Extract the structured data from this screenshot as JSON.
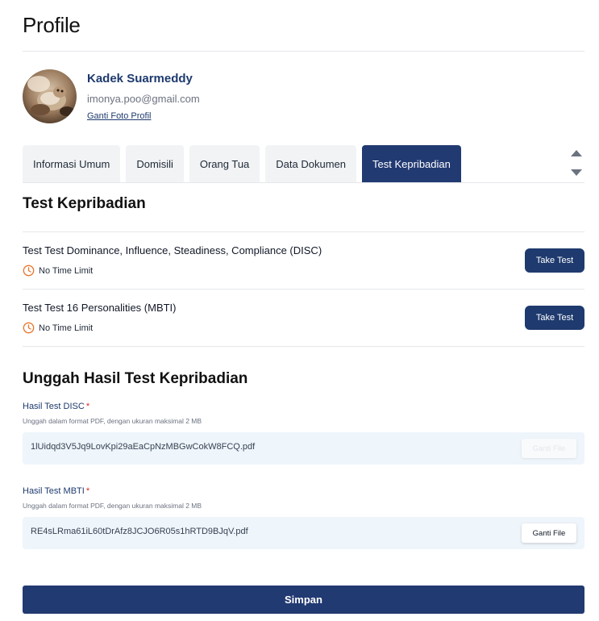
{
  "page": {
    "title": "Profile"
  },
  "profile": {
    "name": "Kadek Suarmeddy",
    "email": "imonya.poo@gmail.com",
    "change_photo_label": "Ganti Foto Profil"
  },
  "tabs": [
    {
      "label": "Informasi Umum",
      "active": false
    },
    {
      "label": "Domisili",
      "active": false
    },
    {
      "label": "Orang Tua",
      "active": false
    },
    {
      "label": "Data Dokumen",
      "active": false
    },
    {
      "label": "Test Kepribadian",
      "active": true
    }
  ],
  "personality": {
    "title": "Test Kepribadian",
    "tests": [
      {
        "name": "Test Test Dominance, Influence, Steadiness, Compliance (DISC)",
        "time": "No Time Limit",
        "button": "Take Test"
      },
      {
        "name": "Test Test 16 Personalities (MBTI)",
        "time": "No Time Limit",
        "button": "Take Test"
      }
    ]
  },
  "upload": {
    "title": "Unggah Hasil Test Kepribadian",
    "fields": [
      {
        "label": "Hasil Test DISC",
        "required_mark": "*",
        "help": "Unggah dalam format PDF, dengan ukuran maksimal 2 MB",
        "file": "1lUidqd3V5Jq9LovKpi29aEaCpNzMBGwCokW8FCQ.pdf",
        "button": "Ganti File"
      },
      {
        "label": "Hasil Test MBTI",
        "required_mark": "*",
        "help": "Unggah dalam format PDF, dengan ukuran maksimal 2 MB",
        "file": "RE4sLRma61iL60tDrAfz8JCJO6R05s1hRTD9BJqV.pdf",
        "button": "Ganti File"
      }
    ]
  },
  "submit_label": "Simpan",
  "colors": {
    "primary": "#1e3a6e",
    "tab_active": "#223a72",
    "clock": "#e8772e",
    "required": "#dc2626",
    "file_bg": "#eef5fb"
  },
  "icons": {
    "clock": "clock-icon",
    "scroll_up": "arrow-up-icon",
    "scroll_down": "arrow-down-icon"
  }
}
